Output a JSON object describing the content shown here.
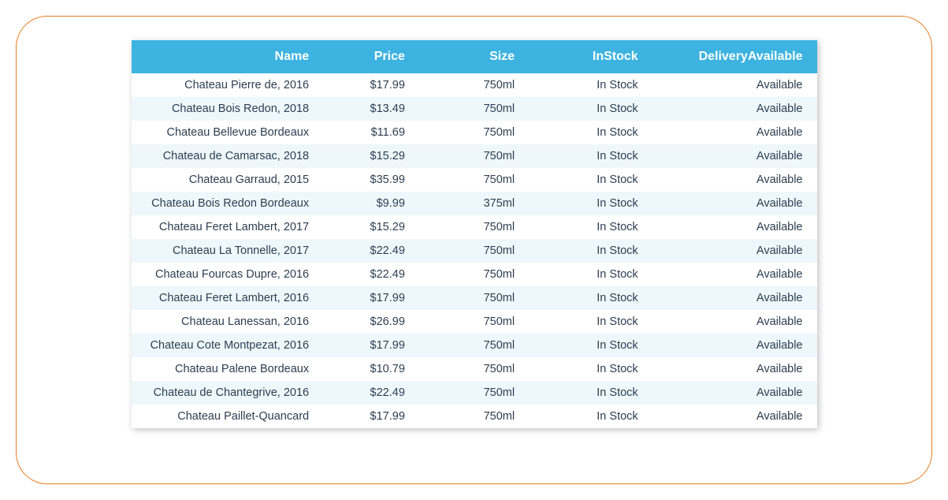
{
  "table": {
    "headers": [
      "Name",
      "Price",
      "Size",
      "InStock",
      "DeliveryAvailable"
    ],
    "rows": [
      {
        "name": "Chateau Pierre de, 2016",
        "price": "$17.99",
        "size": "750ml",
        "instock": "In Stock",
        "delivery": "Available"
      },
      {
        "name": "Chateau Bois Redon, 2018",
        "price": "$13.49",
        "size": "750ml",
        "instock": "In Stock",
        "delivery": "Available"
      },
      {
        "name": "Chateau Bellevue Bordeaux",
        "price": "$11.69",
        "size": "750ml",
        "instock": "In Stock",
        "delivery": "Available"
      },
      {
        "name": "Chateau de Camarsac, 2018",
        "price": "$15.29",
        "size": "750ml",
        "instock": "In Stock",
        "delivery": "Available"
      },
      {
        "name": "Chateau Garraud, 2015",
        "price": "$35.99",
        "size": "750ml",
        "instock": "In Stock",
        "delivery": "Available"
      },
      {
        "name": "Chateau Bois Redon Bordeaux",
        "price": "$9.99",
        "size": "375ml",
        "instock": "In Stock",
        "delivery": "Available"
      },
      {
        "name": "Chateau Feret Lambert, 2017",
        "price": "$15.29",
        "size": "750ml",
        "instock": "In Stock",
        "delivery": "Available"
      },
      {
        "name": "Chateau La Tonnelle, 2017",
        "price": "$22.49",
        "size": "750ml",
        "instock": "In Stock",
        "delivery": "Available"
      },
      {
        "name": "Chateau Fourcas Dupre, 2016",
        "price": "$22.49",
        "size": "750ml",
        "instock": "In Stock",
        "delivery": "Available"
      },
      {
        "name": "Chateau Feret Lambert, 2016",
        "price": "$17.99",
        "size": "750ml",
        "instock": "In Stock",
        "delivery": "Available"
      },
      {
        "name": "Chateau Lanessan, 2016",
        "price": "$26.99",
        "size": "750ml",
        "instock": "In Stock",
        "delivery": "Available"
      },
      {
        "name": "Chateau Cote Montpezat, 2016",
        "price": "$17.99",
        "size": "750ml",
        "instock": "In Stock",
        "delivery": "Available"
      },
      {
        "name": "Chateau Palene Bordeaux",
        "price": "$10.79",
        "size": "750ml",
        "instock": "In Stock",
        "delivery": "Available"
      },
      {
        "name": "Chateau de Chantegrive, 2016",
        "price": "$22.49",
        "size": "750ml",
        "instock": "In Stock",
        "delivery": "Available"
      },
      {
        "name": "Chateau Paillet-Quancard",
        "price": "$17.99",
        "size": "750ml",
        "instock": "In Stock",
        "delivery": "Available"
      }
    ]
  }
}
